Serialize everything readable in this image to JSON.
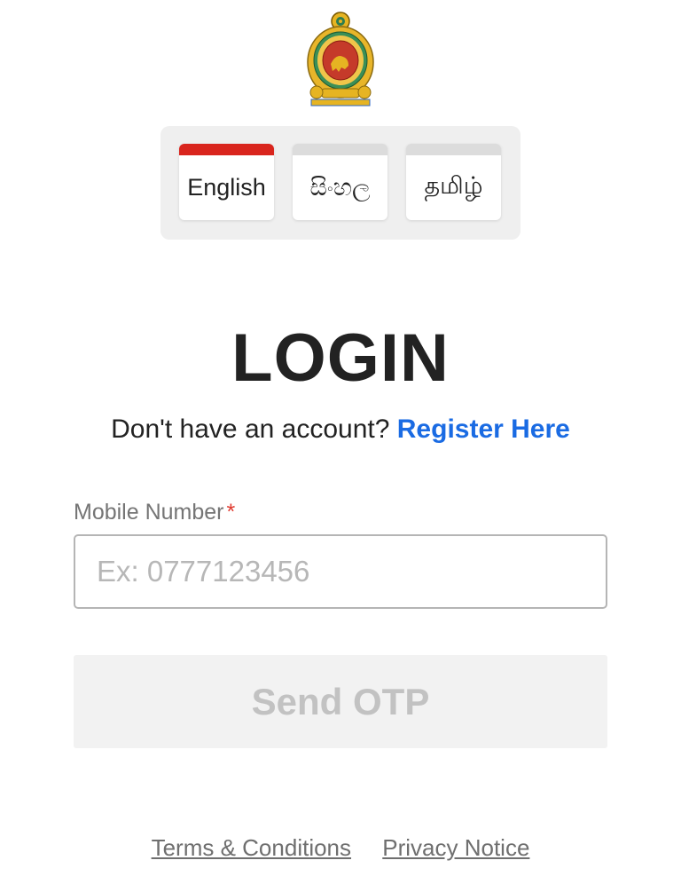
{
  "languages": [
    {
      "label": "English",
      "active": true
    },
    {
      "label": "සිංහල",
      "active": false
    },
    {
      "label": "தமிழ்",
      "active": false
    }
  ],
  "login": {
    "title": "LOGIN",
    "no_account_text": "Don't have an account?",
    "register_link": "Register Here"
  },
  "mobile_field": {
    "label": "Mobile Number",
    "required_marker": "*",
    "placeholder": "Ex: 0777123456",
    "value": ""
  },
  "send_otp_label": "Send OTP",
  "footer": {
    "terms": "Terms & Conditions",
    "privacy": "Privacy Notice"
  },
  "colors": {
    "accent_blue": "#1a6be3",
    "active_tab_red": "#d9251d",
    "required_red": "#e03a2f"
  },
  "icons": {
    "emblem": "sri-lanka-emblem-icon"
  }
}
